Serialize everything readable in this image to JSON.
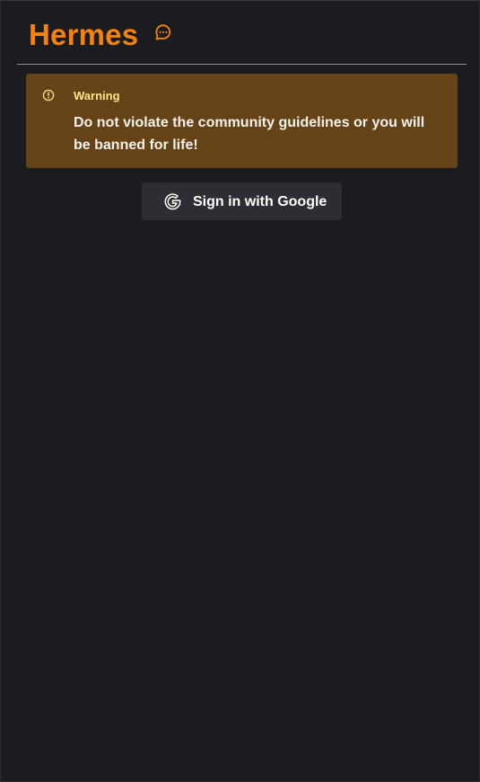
{
  "header": {
    "title": "Hermes",
    "icon": "chat-bubble-icon",
    "accent_color": "#f5820e"
  },
  "alert": {
    "title": "Warning",
    "message": "Do not violate the community guidelines or you will be banned for life!",
    "icon": "alert-circle-icon",
    "background_color": "#654316",
    "title_color": "#fde68a"
  },
  "auth": {
    "google_button_label": "Sign in with Google",
    "icon": "google-icon"
  }
}
